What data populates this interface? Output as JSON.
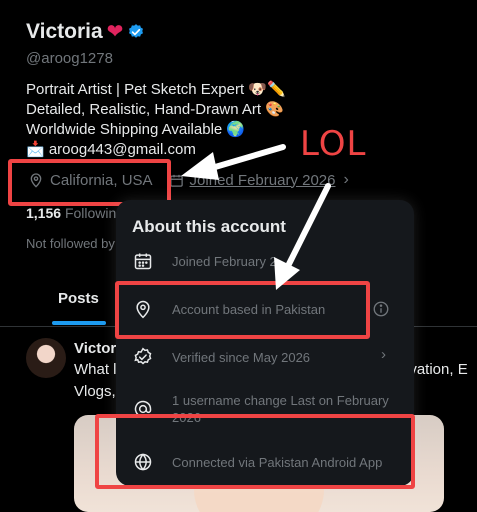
{
  "profile": {
    "display_name": "Victoria",
    "heart_emoji": "❤️",
    "handle": "@aroog1278",
    "bio_line1": "Portrait Artist | Pet Sketch Expert 🐶✏️",
    "bio_line2": "Detailed, Realistic, Hand-Drawn Art 🎨",
    "bio_line3": "Worldwide Shipping Available 🌍",
    "bio_line4": "📩 aroog443@gmail.com",
    "location": "California, USA",
    "joined": "Joined February 2026",
    "following_count": "1,156",
    "following_label": "Followin",
    "not_followed": "Not followed by"
  },
  "annotation": {
    "lol_text": "LOL",
    "color": "#ef4444"
  },
  "tabs": {
    "posts": "Posts"
  },
  "tweet": {
    "author": "Victor",
    "text_line1": "What l",
    "text_line2": "Vlogs,",
    "text_right": "ivation, E"
  },
  "popup": {
    "title": "About this account",
    "rows": [
      {
        "icon": "calendar-icon",
        "text": "Joined February 2"
      },
      {
        "icon": "location-icon",
        "text": "Account based in Pakistan"
      },
      {
        "icon": "verified-badge-icon",
        "text": "Verified since May 2026"
      },
      {
        "icon": "at-sign-icon",
        "text_line1": "1 username change Last on February",
        "text_line2": "2026"
      },
      {
        "icon": "globe-icon",
        "text": "Connected via Pakistan Android App"
      }
    ]
  },
  "colors": {
    "accent_blue": "#1d9bf0",
    "muted_text": "#71767b",
    "highlight_red": "#ef4444"
  }
}
